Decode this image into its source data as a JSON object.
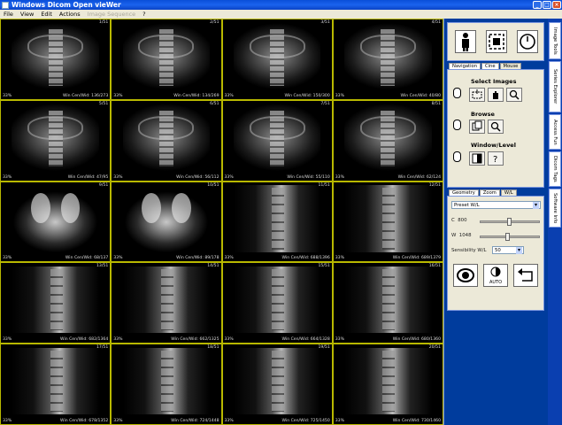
{
  "window": {
    "title": "Windows Dicom Open vieWer"
  },
  "menu": [
    {
      "label": "File",
      "enabled": true
    },
    {
      "label": "View",
      "enabled": true
    },
    {
      "label": "Edit",
      "enabled": true
    },
    {
      "label": "Actions",
      "enabled": true
    },
    {
      "label": "Image Sequence",
      "enabled": false
    },
    {
      "label": "?",
      "enabled": true
    }
  ],
  "grid": {
    "cells": [
      {
        "index": "1/51",
        "zoom": "33%",
        "wl": "Win Cen/Wid: 136/273",
        "kind": "coronal"
      },
      {
        "index": "2/51",
        "zoom": "33%",
        "wl": "Win Cen/Wid: 134/269",
        "kind": "coronal"
      },
      {
        "index": "3/51",
        "zoom": "33%",
        "wl": "Win Cen/Wid: 150/300",
        "kind": "coronal"
      },
      {
        "index": "4/51",
        "zoom": "33%",
        "wl": "Win Cen/Wid: 40/80",
        "kind": "coronal"
      },
      {
        "index": "5/51",
        "zoom": "33%",
        "wl": "Win Cen/Wid: 47/95",
        "kind": "coronal"
      },
      {
        "index": "6/51",
        "zoom": "33%",
        "wl": "Win Cen/Wid: 56/112",
        "kind": "coronal"
      },
      {
        "index": "7/51",
        "zoom": "33%",
        "wl": "Win Cen/Wid: 55/110",
        "kind": "coronal"
      },
      {
        "index": "8/51",
        "zoom": "33%",
        "wl": "Win Cen/Wid: 62/124",
        "kind": "coronal"
      },
      {
        "index": "9/51",
        "zoom": "33%",
        "wl": "Win Cen/Wid: 68/137",
        "kind": "axialish"
      },
      {
        "index": "10/51",
        "zoom": "33%",
        "wl": "Win Cen/Wid: 89/178",
        "kind": "axialish"
      },
      {
        "index": "11/51",
        "zoom": "33%",
        "wl": "Win Cen/Wid: 688/1396",
        "kind": "sagittal"
      },
      {
        "index": "12/51",
        "zoom": "33%",
        "wl": "Win Cen/Wid: 689/1379",
        "kind": "sagittal"
      },
      {
        "index": "13/51",
        "zoom": "33%",
        "wl": "Win Cen/Wid: 682/1364",
        "kind": "sagittal"
      },
      {
        "index": "14/51",
        "zoom": "33%",
        "wl": "Win Cen/Wid: 662/1325",
        "kind": "sagittal"
      },
      {
        "index": "15/51",
        "zoom": "33%",
        "wl": "Win Cen/Wid: 664/1328",
        "kind": "sagittal"
      },
      {
        "index": "16/51",
        "zoom": "33%",
        "wl": "Win Cen/Wid: 680/1360",
        "kind": "sagittal"
      },
      {
        "index": "17/51",
        "zoom": "33%",
        "wl": "Win Cen/Wid: 678/1352",
        "kind": "sagittal"
      },
      {
        "index": "18/51",
        "zoom": "33%",
        "wl": "Win Cen/Wid: 724/1448",
        "kind": "sagittal"
      },
      {
        "index": "19/51",
        "zoom": "33%",
        "wl": "Win Cen/Wid: 725/1450",
        "kind": "sagittal"
      },
      {
        "index": "20/51",
        "zoom": "33%",
        "wl": "Win Cen/Wid: 730/1460",
        "kind": "sagittal"
      }
    ]
  },
  "panel": {
    "top_icons": [
      "patient-icon",
      "image-select-icon",
      "clock-icon"
    ],
    "tabs1": [
      "Navigation",
      "Cine",
      "Mouse"
    ],
    "mouse": {
      "select_images": "Select Images",
      "browse": "Browse",
      "window_level": "Window/Level"
    },
    "tabs2": [
      "Geometry",
      "Zoom",
      "W/L"
    ],
    "wl": {
      "preset": "Preset W/L",
      "c_label": "C",
      "c_value": "800",
      "w_label": "W",
      "w_value": "1048",
      "sensitivity_label": "Sensibility W/L",
      "sensitivity_value": "50",
      "auto_label": "AUTO"
    }
  },
  "vtabs": [
    "Image Tools",
    "Series Explorer",
    "Access Fun",
    "Dicom Tags",
    "Software Info"
  ]
}
